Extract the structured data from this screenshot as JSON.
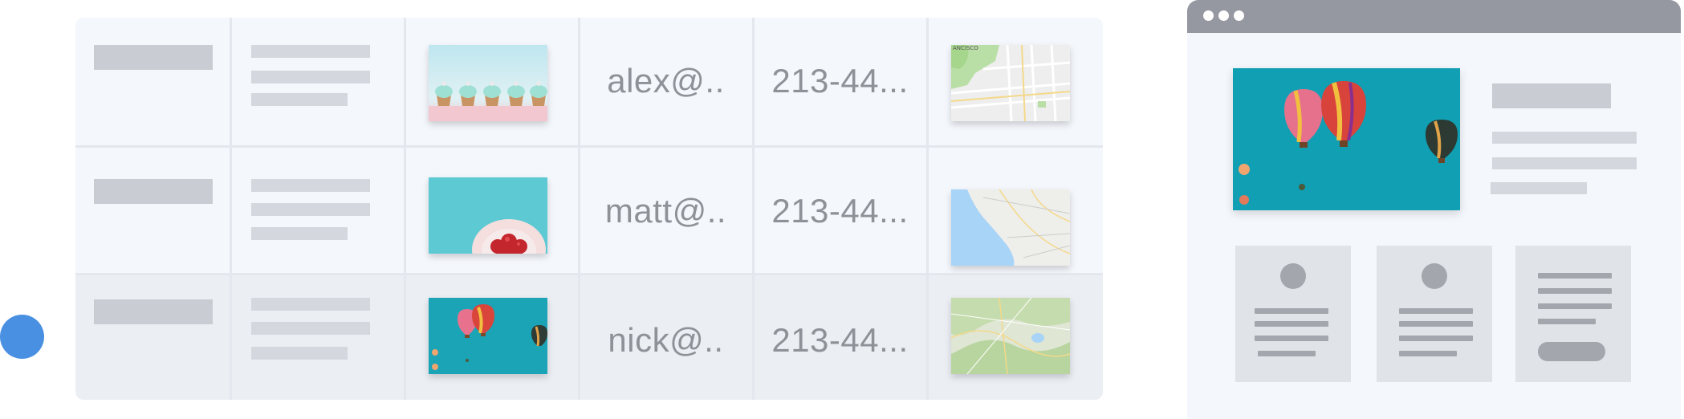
{
  "table": {
    "rows": [
      {
        "email": "alex@..",
        "phone": "213-44...",
        "photo": "cupcakes-photo",
        "map": "city-map"
      },
      {
        "email": "matt@..",
        "phone": "213-44...",
        "photo": "strawberries-photo",
        "map": "coast-map"
      },
      {
        "email": "nick@..",
        "phone": "213-44...",
        "photo": "balloons-photo",
        "map": "terrain-map"
      }
    ]
  },
  "maps": {
    "city_label": "ANCISCO"
  },
  "colors": {
    "accent": "#4a90e2",
    "table_bg": "#f4f7fc",
    "selected_row_bg": "#ebeef3",
    "placeholder_block": "#c9cdd3",
    "text_muted": "#8e9198",
    "browser_titlebar": "#9598a1"
  },
  "icons": {
    "avatar": "blue-circle",
    "window_controls": [
      "dot",
      "dot",
      "dot"
    ]
  }
}
